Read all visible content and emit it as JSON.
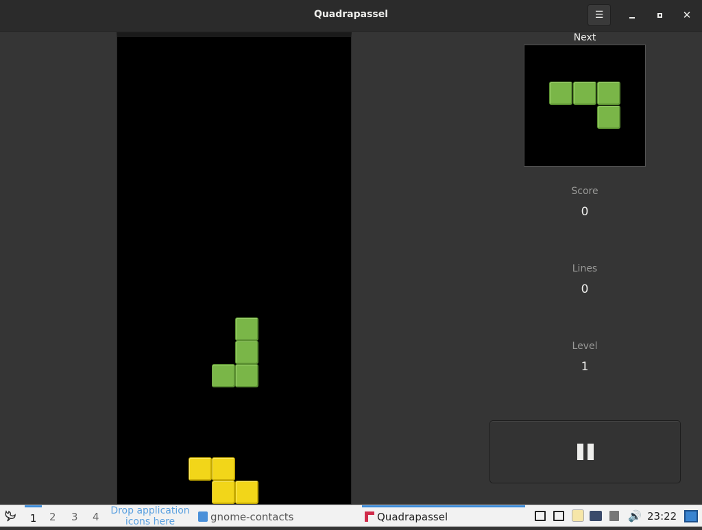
{
  "window": {
    "title": "Quadrapassel",
    "menu_icon": "hamburger-menu-icon",
    "minimize_icon": "minimize-icon",
    "maximize_icon": "maximize-icon",
    "close_icon": "close-icon"
  },
  "board": {
    "columns": 10,
    "rows": 20,
    "cells": [
      {
        "col": 5,
        "row": 12,
        "color": "#7ab648"
      },
      {
        "col": 5,
        "row": 13,
        "color": "#7ab648"
      },
      {
        "col": 4,
        "row": 14,
        "color": "#7ab648"
      },
      {
        "col": 5,
        "row": 14,
        "color": "#7ab648"
      },
      {
        "col": 3,
        "row": 18,
        "color": "#f2d619"
      },
      {
        "col": 4,
        "row": 18,
        "color": "#f2d619"
      },
      {
        "col": 4,
        "row": 19,
        "color": "#f2d619"
      },
      {
        "col": 5,
        "row": 19,
        "color": "#f2d619"
      }
    ]
  },
  "next": {
    "label": "Next",
    "cells": [
      {
        "col": 0,
        "row": 0,
        "color": "#7ab648"
      },
      {
        "col": 1,
        "row": 0,
        "color": "#7ab648"
      },
      {
        "col": 2,
        "row": 0,
        "color": "#7ab648"
      },
      {
        "col": 2,
        "row": 1,
        "color": "#7ab648"
      }
    ]
  },
  "stats": {
    "score_label": "Score",
    "score": "0",
    "lines_label": "Lines",
    "lines": "0",
    "level_label": "Level",
    "level": "1"
  },
  "pause_button": {
    "icon": "pause-icon"
  },
  "taskbar": {
    "menu_icon": "lxde-menu-icon",
    "workspaces": [
      "1",
      "2",
      "3",
      "4"
    ],
    "drop_hint": "Drop application icons here",
    "tasks": [
      {
        "label": "gnome-contacts",
        "icon": "contacts-icon"
      },
      {
        "label": "Quadrapassel",
        "icon": "quadrapassel-icon"
      }
    ],
    "clock": "23:22"
  }
}
